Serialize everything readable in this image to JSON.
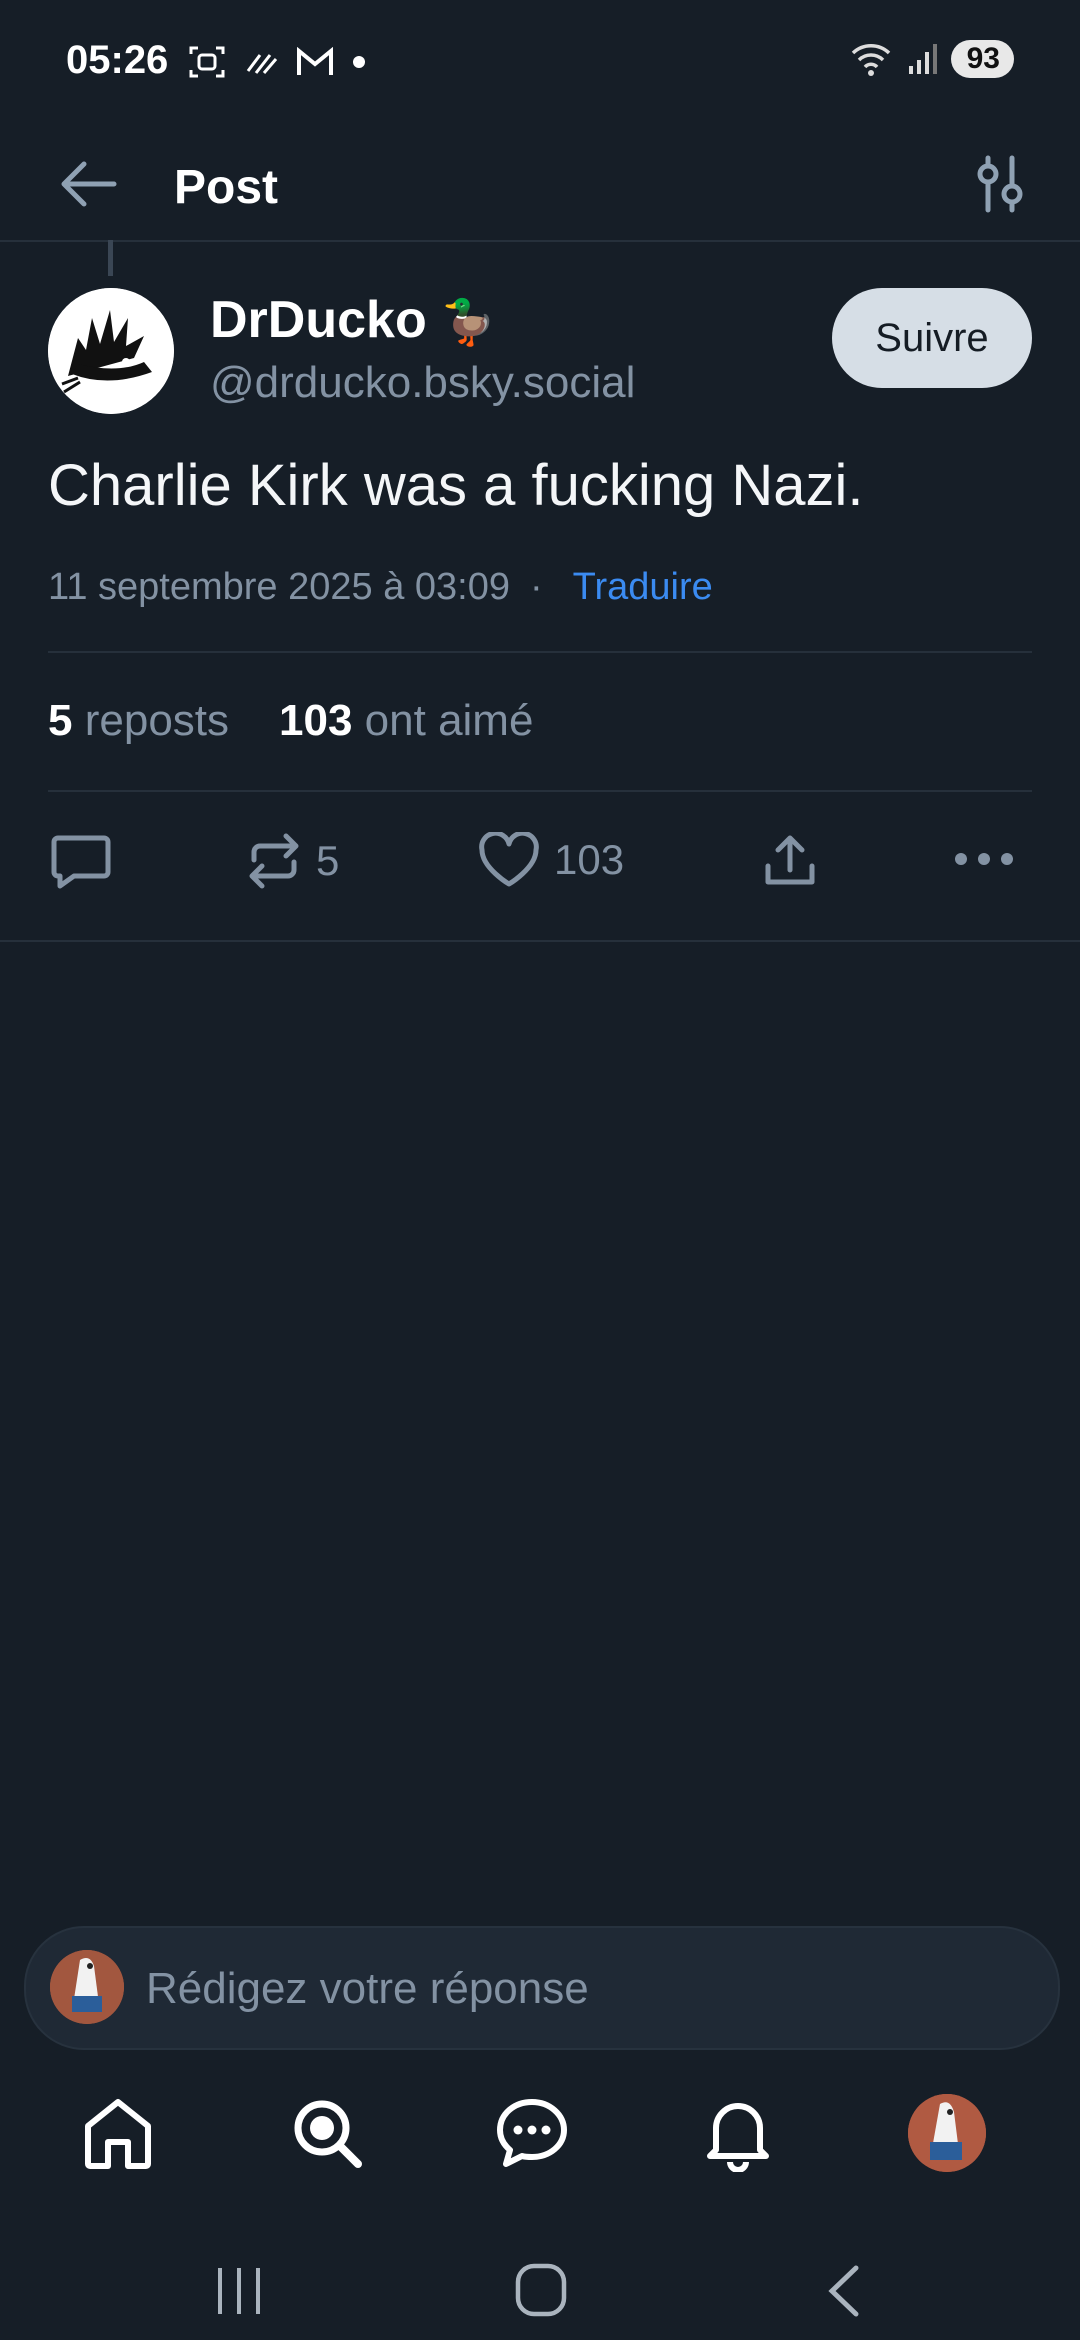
{
  "status_bar": {
    "time": "05:26",
    "battery": "93"
  },
  "header": {
    "title": "Post"
  },
  "post": {
    "author_name": "DrDucko",
    "author_emoji": "🦆",
    "author_handle": "@drducko.bsky.social",
    "follow_label": "Suivre",
    "text": "Charlie Kirk was a fucking Nazi.",
    "timestamp": "11 septembre 2025 à 03:09",
    "separator": "·",
    "translate_label": "Traduire",
    "reposts_count": "5",
    "reposts_label": "reposts",
    "likes_count": "103",
    "likes_label": "ont aimé",
    "action_repost_count": "5",
    "action_like_count": "103"
  },
  "reply": {
    "placeholder": "Rédigez votre réponse"
  },
  "colors": {
    "background": "#161e27",
    "accent": "#3b8bf1",
    "muted": "#8392a3",
    "follow_bg": "#d6dee6"
  },
  "icons": [
    "back-arrow-icon",
    "filter-icon",
    "comment-icon",
    "repost-icon",
    "heart-icon",
    "share-icon",
    "more-icon",
    "home-icon",
    "search-icon",
    "chat-icon",
    "bell-icon"
  ]
}
